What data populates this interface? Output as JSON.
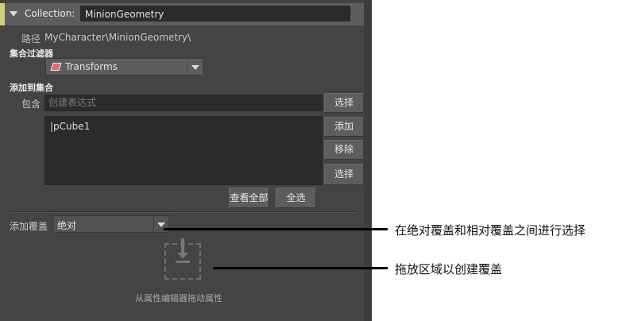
{
  "header": {
    "label": "Collection:",
    "name_value": "MinionGeometry"
  },
  "path": {
    "label": "路径",
    "value": "MyCharacter\\MinionGeometry\\"
  },
  "collection_filter": {
    "title": "集合过滤器",
    "selected": "Transforms"
  },
  "add_to_collection": {
    "title": "添加到集合",
    "include_label": "包含",
    "expression_placeholder": "创建表达式",
    "list_items": [
      "|pCube1"
    ],
    "buttons": {
      "select": "选择",
      "add": "添加",
      "remove": "移除",
      "select2": "选择",
      "view_all": "查看全部",
      "select_all": "全选"
    }
  },
  "override": {
    "label": "添加覆盖",
    "selected": "绝对"
  },
  "drop_zone": {
    "hint": "从属性编辑器拖动属性"
  },
  "callouts": {
    "override_note": "在绝对覆盖和相对覆盖之间进行选择",
    "drop_note": "拖放区域以创建覆盖"
  },
  "colors": {
    "panel": "#444444",
    "header": "#5d5d5d",
    "accent": "#d4cf72",
    "field": "#2b2b2b",
    "button": "#5d5d5d"
  },
  "icons": [
    "collapse-arrow-icon",
    "transform-filter-icon",
    "dropdown-arrow-icon",
    "drop-target-icon"
  ]
}
